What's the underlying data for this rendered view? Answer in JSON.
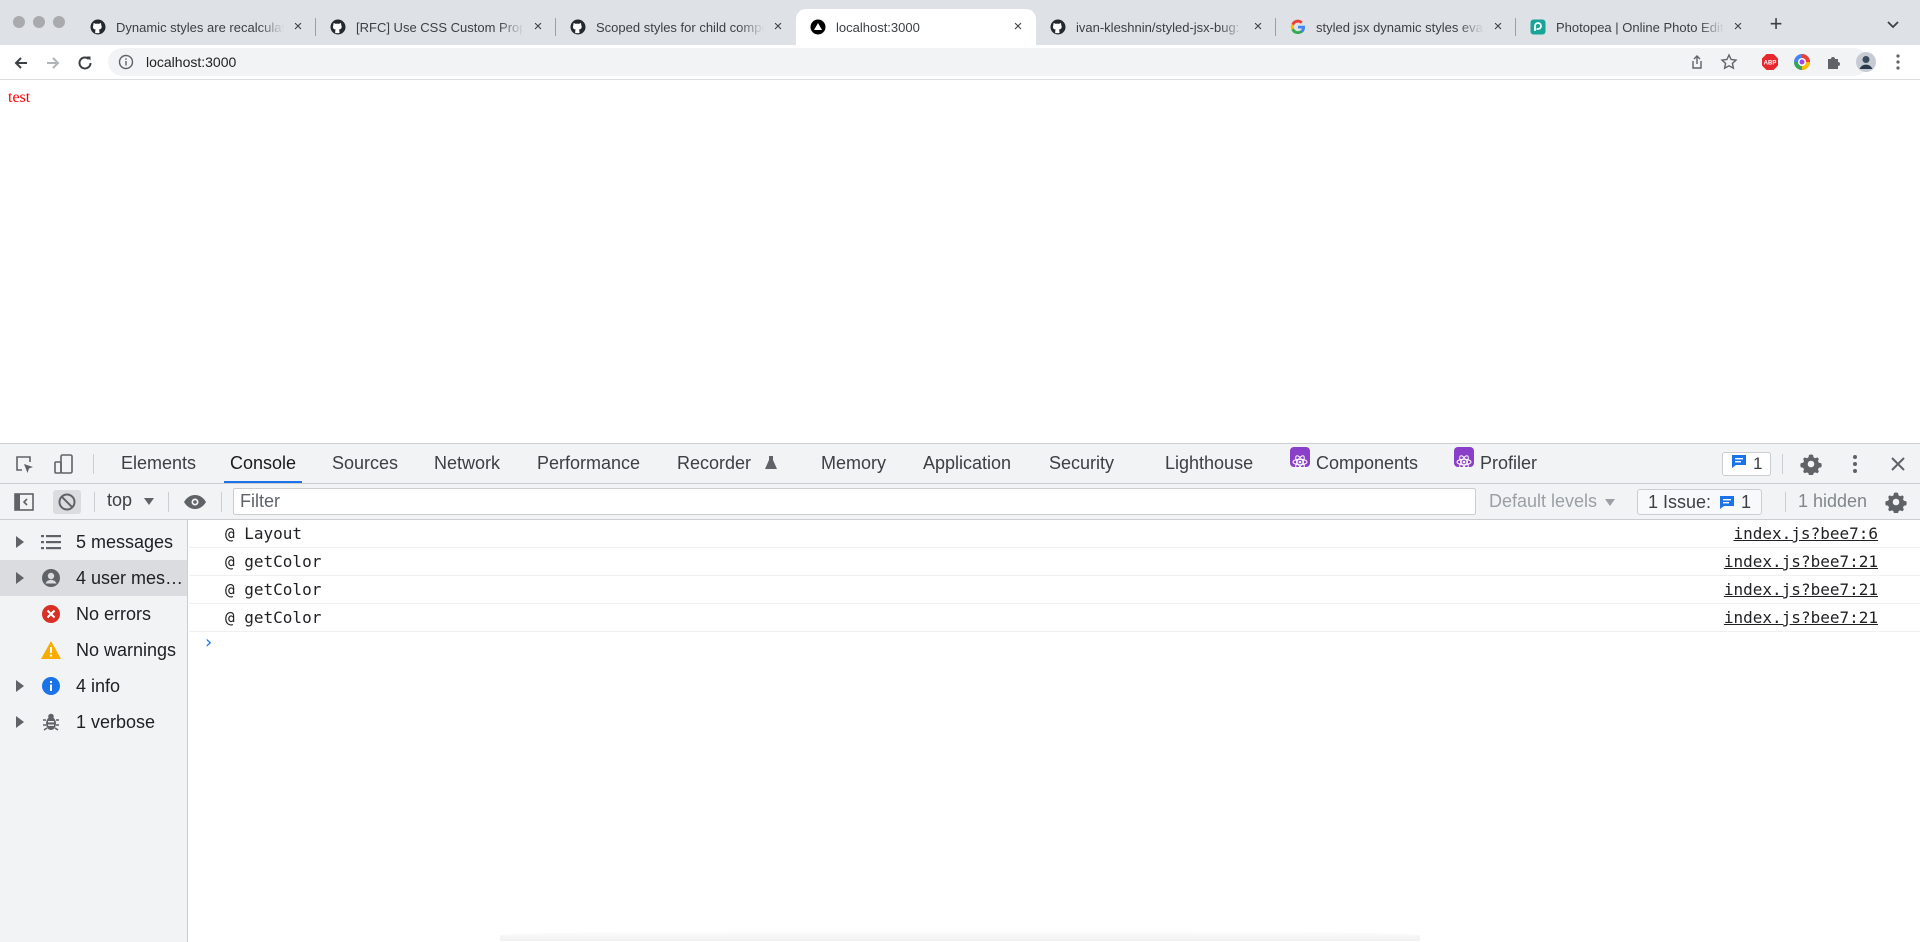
{
  "window": {
    "tabs": [
      {
        "title": "Dynamic styles are recalculate",
        "favicon": "github-icon",
        "active": false
      },
      {
        "title": "[RFC] Use CSS Custom Proper",
        "favicon": "github-icon",
        "active": false
      },
      {
        "title": "Scoped styles for child compo",
        "favicon": "github-icon",
        "active": false
      },
      {
        "title": "localhost:3000",
        "favicon": "triangle-icon",
        "active": true
      },
      {
        "title": "ivan-kleshnin/styled-jsx-bug: S",
        "favicon": "github-icon",
        "active": false
      },
      {
        "title": "styled jsx dynamic styles evalu",
        "favicon": "google-icon",
        "active": false
      },
      {
        "title": "Photopea | Online Photo Editor",
        "favicon": "photopea-icon",
        "active": false
      }
    ],
    "new_tab_label": "+"
  },
  "toolbar": {
    "url": "localhost:3000"
  },
  "page": {
    "text": "test",
    "text_color": "#ff0000"
  },
  "devtools": {
    "tabs": [
      "Elements",
      "Console",
      "Sources",
      "Network",
      "Performance",
      "Recorder",
      "Memory",
      "Application",
      "Security",
      "Lighthouse",
      "Components",
      "Profiler"
    ],
    "active_tab": "Console",
    "issues_count": "1",
    "context": "top",
    "filter_placeholder": "Filter",
    "levels_label": "Default levels",
    "issue_button_label": "1 Issue:",
    "issue_button_count": "1",
    "hidden_label": "1 hidden",
    "sidebar": [
      {
        "label": "5 messages",
        "icon": "list-icon",
        "expandable": true,
        "selected": false
      },
      {
        "label": "4 user mes…",
        "icon": "user-icon",
        "expandable": true,
        "selected": true
      },
      {
        "label": "No errors",
        "icon": "error-icon",
        "expandable": false,
        "selected": false
      },
      {
        "label": "No warnings",
        "icon": "warning-icon",
        "expandable": false,
        "selected": false
      },
      {
        "label": "4 info",
        "icon": "info-icon",
        "expandable": true,
        "selected": false
      },
      {
        "label": "1 verbose",
        "icon": "bug-icon",
        "expandable": true,
        "selected": false
      }
    ],
    "console_rows": [
      {
        "message": "@ Layout",
        "source": "index.js?bee7:6"
      },
      {
        "message": "@ getColor",
        "source": "index.js?bee7:21"
      },
      {
        "message": "@ getColor",
        "source": "index.js?bee7:21"
      },
      {
        "message": "@ getColor",
        "source": "index.js?bee7:21"
      }
    ],
    "prompt_symbol": "›"
  },
  "colors": {
    "accent": "#1a73e8",
    "error": "#d93025",
    "warning": "#f9ab00",
    "react": "#8a3fc9"
  }
}
